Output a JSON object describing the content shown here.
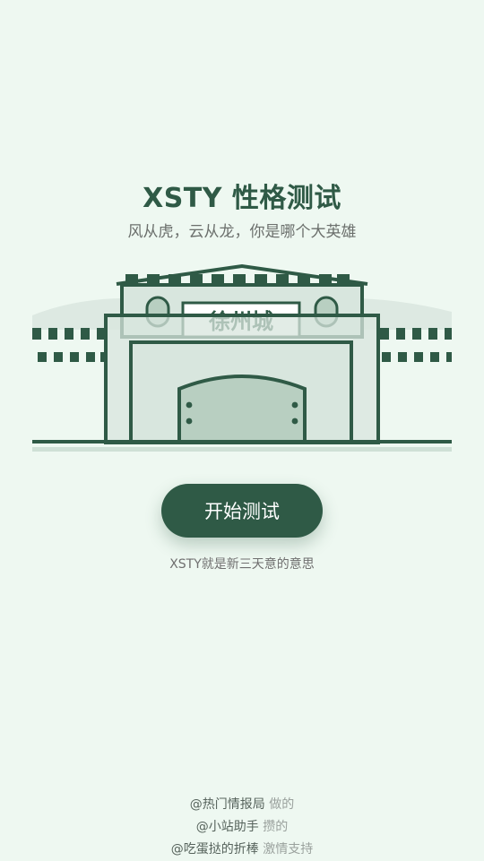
{
  "header": {
    "title": "XSTY 性格测试",
    "subtitle": "风从虎，云从龙，你是哪个大英雄"
  },
  "illustration": {
    "gate_sign": "徐州城"
  },
  "actions": {
    "start_label": "开始测试",
    "note": "XSTY就是新三天意的意思"
  },
  "credits": [
    {
      "name": "@热门情报局",
      "suffix": "做的"
    },
    {
      "name": "@小站助手",
      "suffix": "攒的"
    },
    {
      "name": "@吃蛋挞的折棒",
      "suffix": "激情支持"
    }
  ],
  "colors": {
    "background": "#eef8f1",
    "primary": "#2f5a46",
    "wall_fill": "#d8e6de",
    "door_fill": "#b8cfc1"
  }
}
